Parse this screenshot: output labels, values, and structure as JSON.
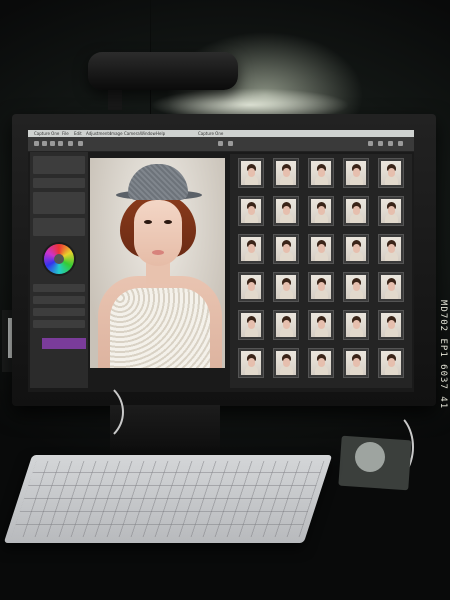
{
  "image": {
    "film_edge_text": "MD702 EP1 6037  41"
  },
  "screen": {
    "app_title": "Capture One",
    "menu_items": [
      "Capture One",
      "File",
      "Edit",
      "Adjustments",
      "Image",
      "Camera",
      "Window",
      "Help"
    ],
    "thumbnail_count": 30
  },
  "colors": {
    "accent_purple": "#7a3c9a",
    "lamp_glow": "#e8f0dc"
  }
}
